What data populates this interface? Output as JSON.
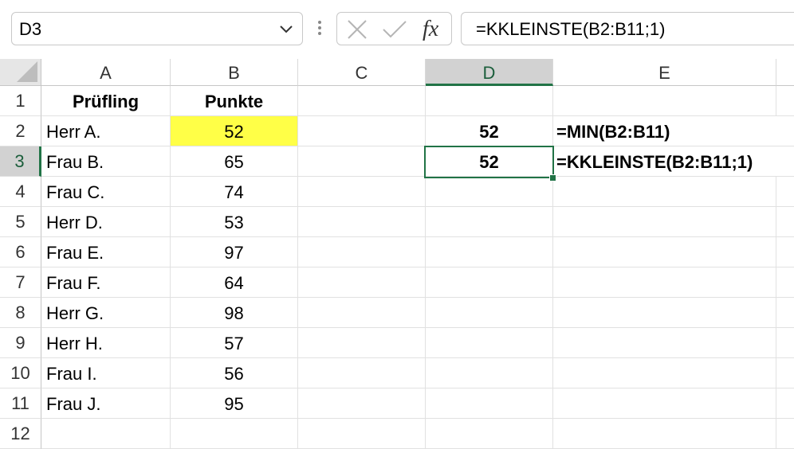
{
  "formula_bar": {
    "name_box": "D3",
    "formula": "=KKLEINSTE(B2:B11;1)"
  },
  "icons": {
    "name_box_dropdown": "chevron-down-icon",
    "more": "vertical-dots-icon",
    "cancel": "close-icon",
    "enter": "check-icon",
    "insert_function": "fx-icon"
  },
  "columns": [
    "A",
    "B",
    "C",
    "D",
    "E"
  ],
  "rows": [
    "1",
    "2",
    "3",
    "4",
    "5",
    "6",
    "7",
    "8",
    "9",
    "10",
    "11",
    "12"
  ],
  "cells": {
    "A1": "Prüfling",
    "B1": "Punkte",
    "A2": "Herr A.",
    "B2": "52",
    "D2": "52",
    "E2": "=MIN(B2:B11)",
    "A3": "Frau B.",
    "B3": "65",
    "D3": "52",
    "E3": "=KKLEINSTE(B2:B11;1)",
    "A4": "Frau C.",
    "B4": "74",
    "A5": "Herr D.",
    "B5": "53",
    "A6": "Frau E.",
    "B6": "97",
    "A7": "Frau F.",
    "B7": "64",
    "A8": "Herr G.",
    "B8": "98",
    "A9": "Herr H.",
    "B9": "57",
    "A10": "Frau I.",
    "B10": "56",
    "A11": "Frau J.",
    "B11": "95"
  },
  "colors": {
    "highlight": "#ffff47",
    "selection": "#217346"
  }
}
